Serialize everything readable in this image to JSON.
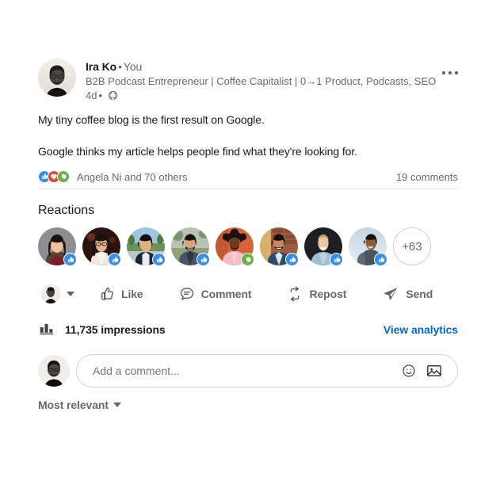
{
  "post": {
    "author": {
      "name": "Ira Ko",
      "separator": "•",
      "relationship": "You",
      "headline": "B2B Podcast Entrepreneur | Coffee Capitalist | 0→1 Product, Podcasts, SEO",
      "time": "4d",
      "visibility_icon": "globe-icon",
      "avatar_icon": "author-avatar-photo"
    },
    "more_menu_icon": "more-options-icon",
    "body": {
      "paragraph_1": "My tiny coffee blog is the first result on Google.",
      "paragraph_2": "Google thinks my article helps people find what they're looking for."
    },
    "social": {
      "reaction_icons": [
        "like-reaction-icon",
        "love-reaction-icon",
        "support-reaction-icon"
      ],
      "summary": "Angela Ni and 70 others",
      "comments": "19 comments"
    }
  },
  "reactions": {
    "title": "Reactions",
    "people": [
      {
        "badge": "like",
        "badge_icon": "like-reaction-badge"
      },
      {
        "badge": "like",
        "badge_icon": "like-reaction-badge"
      },
      {
        "badge": "like",
        "badge_icon": "like-reaction-badge"
      },
      {
        "badge": "like",
        "badge_icon": "like-reaction-badge"
      },
      {
        "badge": "support",
        "badge_icon": "support-reaction-badge"
      },
      {
        "badge": "like",
        "badge_icon": "like-reaction-badge"
      },
      {
        "badge": "like",
        "badge_icon": "like-reaction-badge"
      },
      {
        "badge": "like",
        "badge_icon": "like-reaction-badge"
      }
    ],
    "overflow_label": "+63"
  },
  "actions": {
    "react_as_icon": "current-user-avatar",
    "react_as_caret_icon": "chevron-down-icon",
    "like": {
      "label": "Like",
      "icon": "thumbs-up-icon"
    },
    "comment": {
      "label": "Comment",
      "icon": "comment-bubble-icon"
    },
    "repost": {
      "label": "Repost",
      "icon": "repost-icon"
    },
    "send": {
      "label": "Send",
      "icon": "send-plane-icon"
    }
  },
  "analytics": {
    "icon": "bar-chart-icon",
    "impressions": "11,735 impressions",
    "view_link": "View analytics"
  },
  "comment_box": {
    "avatar_icon": "current-user-avatar",
    "placeholder": "Add a comment...",
    "value": "",
    "emoji_icon": "emoji-smiley-icon",
    "image_icon": "image-upload-icon"
  },
  "sort": {
    "label": "Most relevant",
    "caret_icon": "chevron-down-icon"
  },
  "colors": {
    "link_blue": "#0a66c2",
    "like_blue": "#378fe9",
    "love_red": "#e04a32",
    "support_green": "#6dae4f",
    "text_primary": "rgba(0,0,0,0.9)",
    "text_secondary": "rgba(0,0,0,0.6)",
    "divider": "#e8e8e8"
  }
}
